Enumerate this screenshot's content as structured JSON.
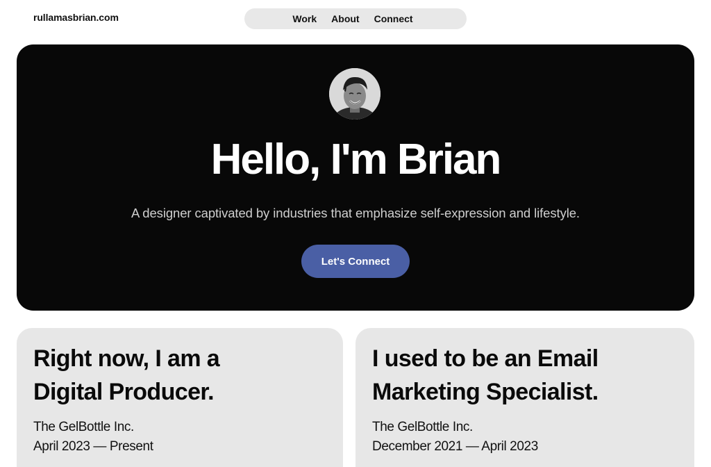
{
  "header": {
    "logo": "rullamasbrian.com",
    "nav": [
      "Work",
      "About",
      "Connect"
    ]
  },
  "hero": {
    "avatar_alt": "avatar",
    "title": "Hello, I'm Brian",
    "subtitle": "A designer captivated by industries that emphasize self-expression and lifestyle.",
    "cta_label": "Let's Connect"
  },
  "cards": [
    {
      "heading_line1": "Right now, I am a",
      "heading_line2": "Digital Producer.",
      "company": "The GelBottle Inc.",
      "dates": "April 2023 — Present"
    },
    {
      "heading_line1": "I used to be an Email",
      "heading_line2": "Marketing Specialist.",
      "company": "The GelBottle Inc.",
      "dates": "December 2021 — April 2023"
    }
  ],
  "colors": {
    "hero_background": "#080808",
    "cta_background": "#4a5fa5",
    "card_background": "#e7e7e7",
    "nav_background": "#e8e8e8"
  }
}
